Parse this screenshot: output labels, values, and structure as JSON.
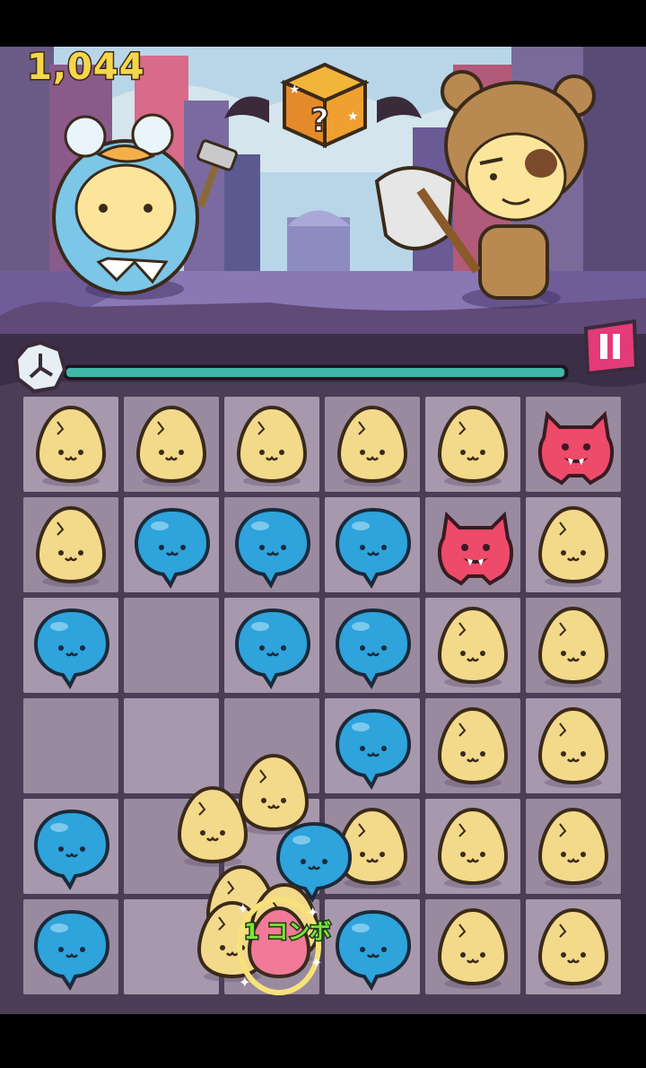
{
  "hud": {
    "score": "1,044",
    "combo_text": "1 コンボ"
  },
  "board": {
    "rows": 6,
    "cols": 6,
    "pieces": [
      [
        "egg",
        "egg",
        "egg",
        "egg",
        "egg",
        "devil"
      ],
      [
        "egg",
        "blob",
        "blob",
        "blob",
        "devil",
        "egg"
      ],
      [
        "blob",
        "empty",
        "blob",
        "blob",
        "egg",
        "egg"
      ],
      [
        "empty",
        "empty",
        "empty",
        "blob",
        "egg",
        "egg"
      ],
      [
        "blob",
        "empty",
        "empty",
        "egg",
        "egg",
        "egg"
      ],
      [
        "blob",
        "empty",
        "empty",
        "blob",
        "egg",
        "egg"
      ]
    ]
  },
  "colors": {
    "egg": "#f3d98a",
    "blob": "#2ea3dc",
    "devil": "#ee4a6a",
    "timer_bar": "#3fb8a8",
    "score": "#f6d64a",
    "combo": "#7fe23a"
  },
  "icons": [
    "clock-icon",
    "pause-icon",
    "mystery-box-icon"
  ]
}
